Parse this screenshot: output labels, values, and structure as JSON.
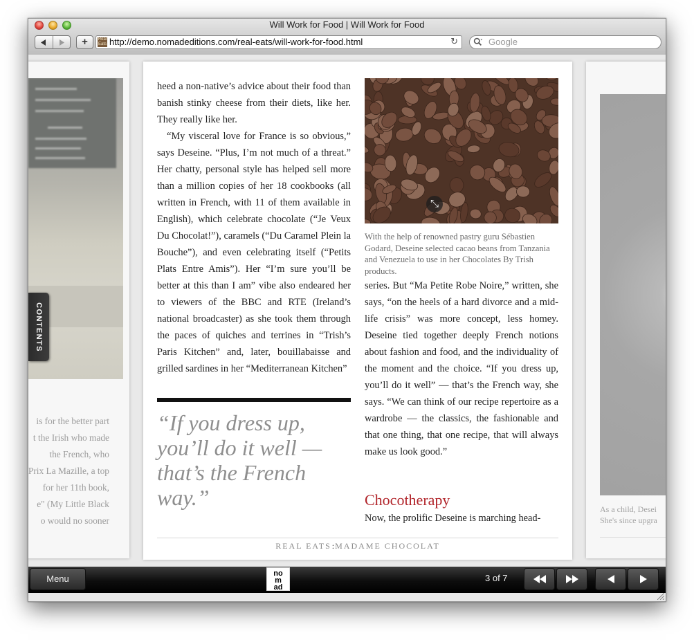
{
  "window": {
    "title": "Will Work for Food | Will Work for Food"
  },
  "toolbar": {
    "back_icon": "back-arrow-icon",
    "forward_icon": "forward-arrow-icon",
    "add_label": "+",
    "favicon_text": "Real Eats",
    "url": "http://demo.nomadeditions.com/real-eats/will-work-for-food.html",
    "search_placeholder": "Google"
  },
  "left_page": {
    "lines": [
      "is for the better part",
      "t the Irish who made",
      "the French, who",
      "Prix La Mazille, a top",
      "for her 11th book,",
      "e\" (My Little Black",
      "o would no sooner"
    ]
  },
  "contents_tab": {
    "label": "CONTENTS"
  },
  "article": {
    "col1_paragraphs": [
      "heed a non-native’s advice about their food than banish stinky cheese from their diets, like her. They really like her.",
      "“My visceral love for France is so obvious,” says Deseine. “Plus, I’m not much of a threat.” Her chatty, personal style has helped sell more than a million copies of her 18 cookbooks (all written in French, with 11 of them available in English), which celebrate chocolate (“Je Veux Du Chocolat!”), caramels (“Du Caramel Plein la Bouche”), and even celebrating itself (“Petits Plats Entre Amis”). Her “I’m sure you’ll be better at this than I am” vibe also endeared her to viewers of the BBC and RTE (Ireland’s national broadcaster) as she took them through the paces of quiches and terrines in “Trish’s Paris Kitchen” and, later, bouillabaisse and grilled sardines in her “Mediterranean Kitchen”"
    ],
    "pullquote": "“If you dress up, you’ll do it well — that’s the French way.”",
    "photo_caption": "With the help of renowned pastry guru Sébastien Godard, Deseine selected cacao beans from Tanzania and Venezuela to use in her Chocolates By Trish products.",
    "col2_paragraph": "series. But “Ma Petite Robe Noire,” written, she says, “on the heels of a hard divorce and a mid-life crisis” was more concept, less homey. Deseine tied together deeply French notions about fashion and food, and the individuality of the moment and the choice. “If you dress up, you’ll do it well” — that’s the French way, she says. “We can think of our recipe repertoire as a wardrobe — the classics, the fashionable and that one thing, that one recipe, that will always make us look good.”",
    "subhead": "Chocotherapy",
    "col2_continuation": "Now, the prolific Deseine is marching head-",
    "footer_section": "REAL EATS",
    "footer_separator": ":",
    "footer_title": "MADAME CHOCOLAT",
    "photo_icon_glyph": "⤡"
  },
  "right_page": {
    "caption_lines": [
      "As a child, Desei",
      "She's since upgra"
    ]
  },
  "bottom_bar": {
    "menu_label": "Menu",
    "logo_text": "nomad",
    "page_indicator": "3 of 7",
    "controls": [
      "rewind-icon",
      "fast-forward-icon",
      "previous-page-icon",
      "next-page-icon"
    ]
  },
  "colors": {
    "subhead": "#b1242a",
    "pullquote": "#8e8e8e",
    "bar": "#000000"
  }
}
